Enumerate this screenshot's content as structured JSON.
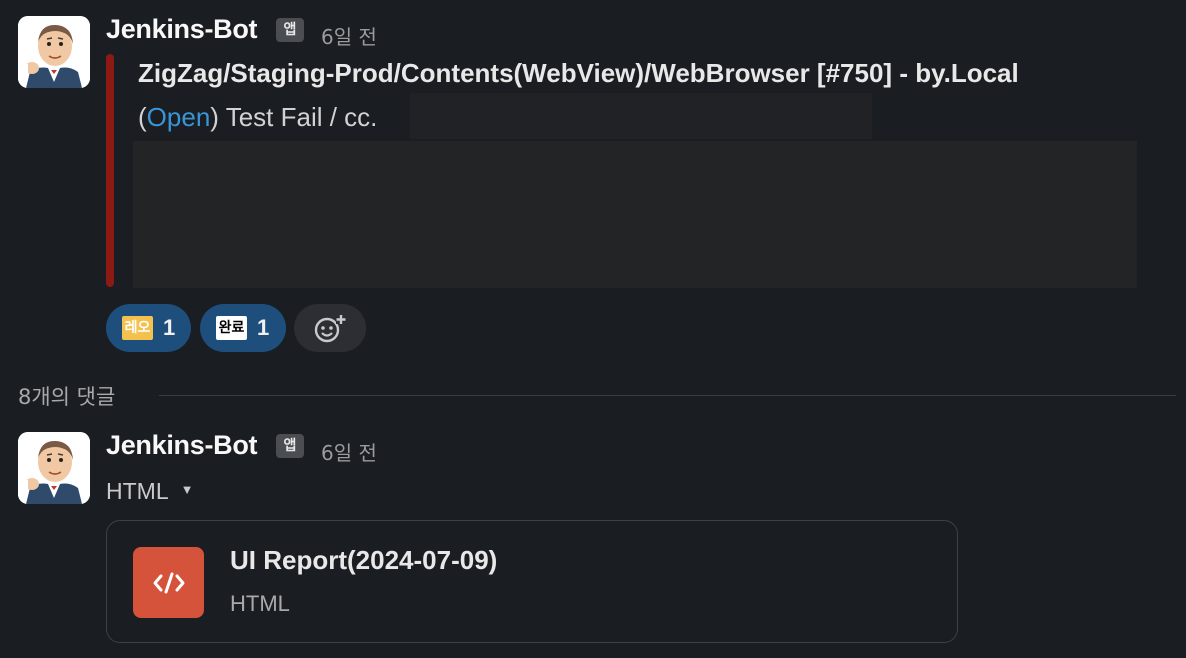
{
  "message": {
    "sender": "Jenkins-Bot",
    "app_badge": "앱",
    "timestamp": "6일 전",
    "attachment": {
      "title": "ZigZag/Staging-Prod/Contents(WebView)/WebBrowser [#750] - by.Local",
      "paren_open": "(",
      "link_text": "Open",
      "after_link": ") Test Fail / cc.",
      "bar_color": "#8b1a14"
    },
    "reactions": [
      {
        "emoji_text": "레오",
        "emoji_bg": "#f2c14e",
        "emoji_color": "#ffffff",
        "count": "1"
      },
      {
        "emoji_text": "완료",
        "emoji_bg": "#ffffff",
        "emoji_color": "#000000",
        "count": "1"
      }
    ],
    "add_reaction_icon": "add-emoji-icon"
  },
  "thread": {
    "reply_count_label": "8개의 댓글"
  },
  "reply": {
    "sender": "Jenkins-Bot",
    "app_badge": "앱",
    "timestamp": "6일 전",
    "file_type_label": "HTML",
    "file": {
      "name": "UI Report(2024-07-09)",
      "kind": "HTML",
      "icon": "code-file-icon",
      "icon_color": "#d5533a"
    }
  }
}
